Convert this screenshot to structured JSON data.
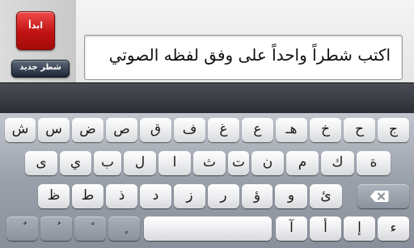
{
  "header": {
    "start_label": "ابدأ",
    "new_line_label": "شطر جديد",
    "prompt": "اكتب شطراً واحداً على وفق لفظه الصوتي"
  },
  "keyboard": {
    "row1": [
      "ج",
      "ح",
      "خ",
      "هـ",
      "ع",
      "غ",
      "ف",
      "ق",
      "ص",
      "ض",
      "س",
      "ش"
    ],
    "row2": [
      "ة",
      "ك",
      "م",
      "ن",
      "ت",
      "ث",
      "ا",
      "ل",
      "ب",
      "ي",
      "ى"
    ],
    "row3": [
      "ئ",
      "و",
      "ؤ",
      "ر",
      "ز",
      "د",
      "ذ",
      "ط",
      "ظ"
    ],
    "row4": [
      "ء",
      "إ",
      "أ",
      "آ",
      "",
      "ٍ",
      "ً",
      "ُ",
      "ٌ"
    ]
  },
  "colors": {
    "start_button": "#c11212",
    "new_line_button": "#1d2636"
  },
  "icons": {
    "backspace": "backspace-icon"
  }
}
